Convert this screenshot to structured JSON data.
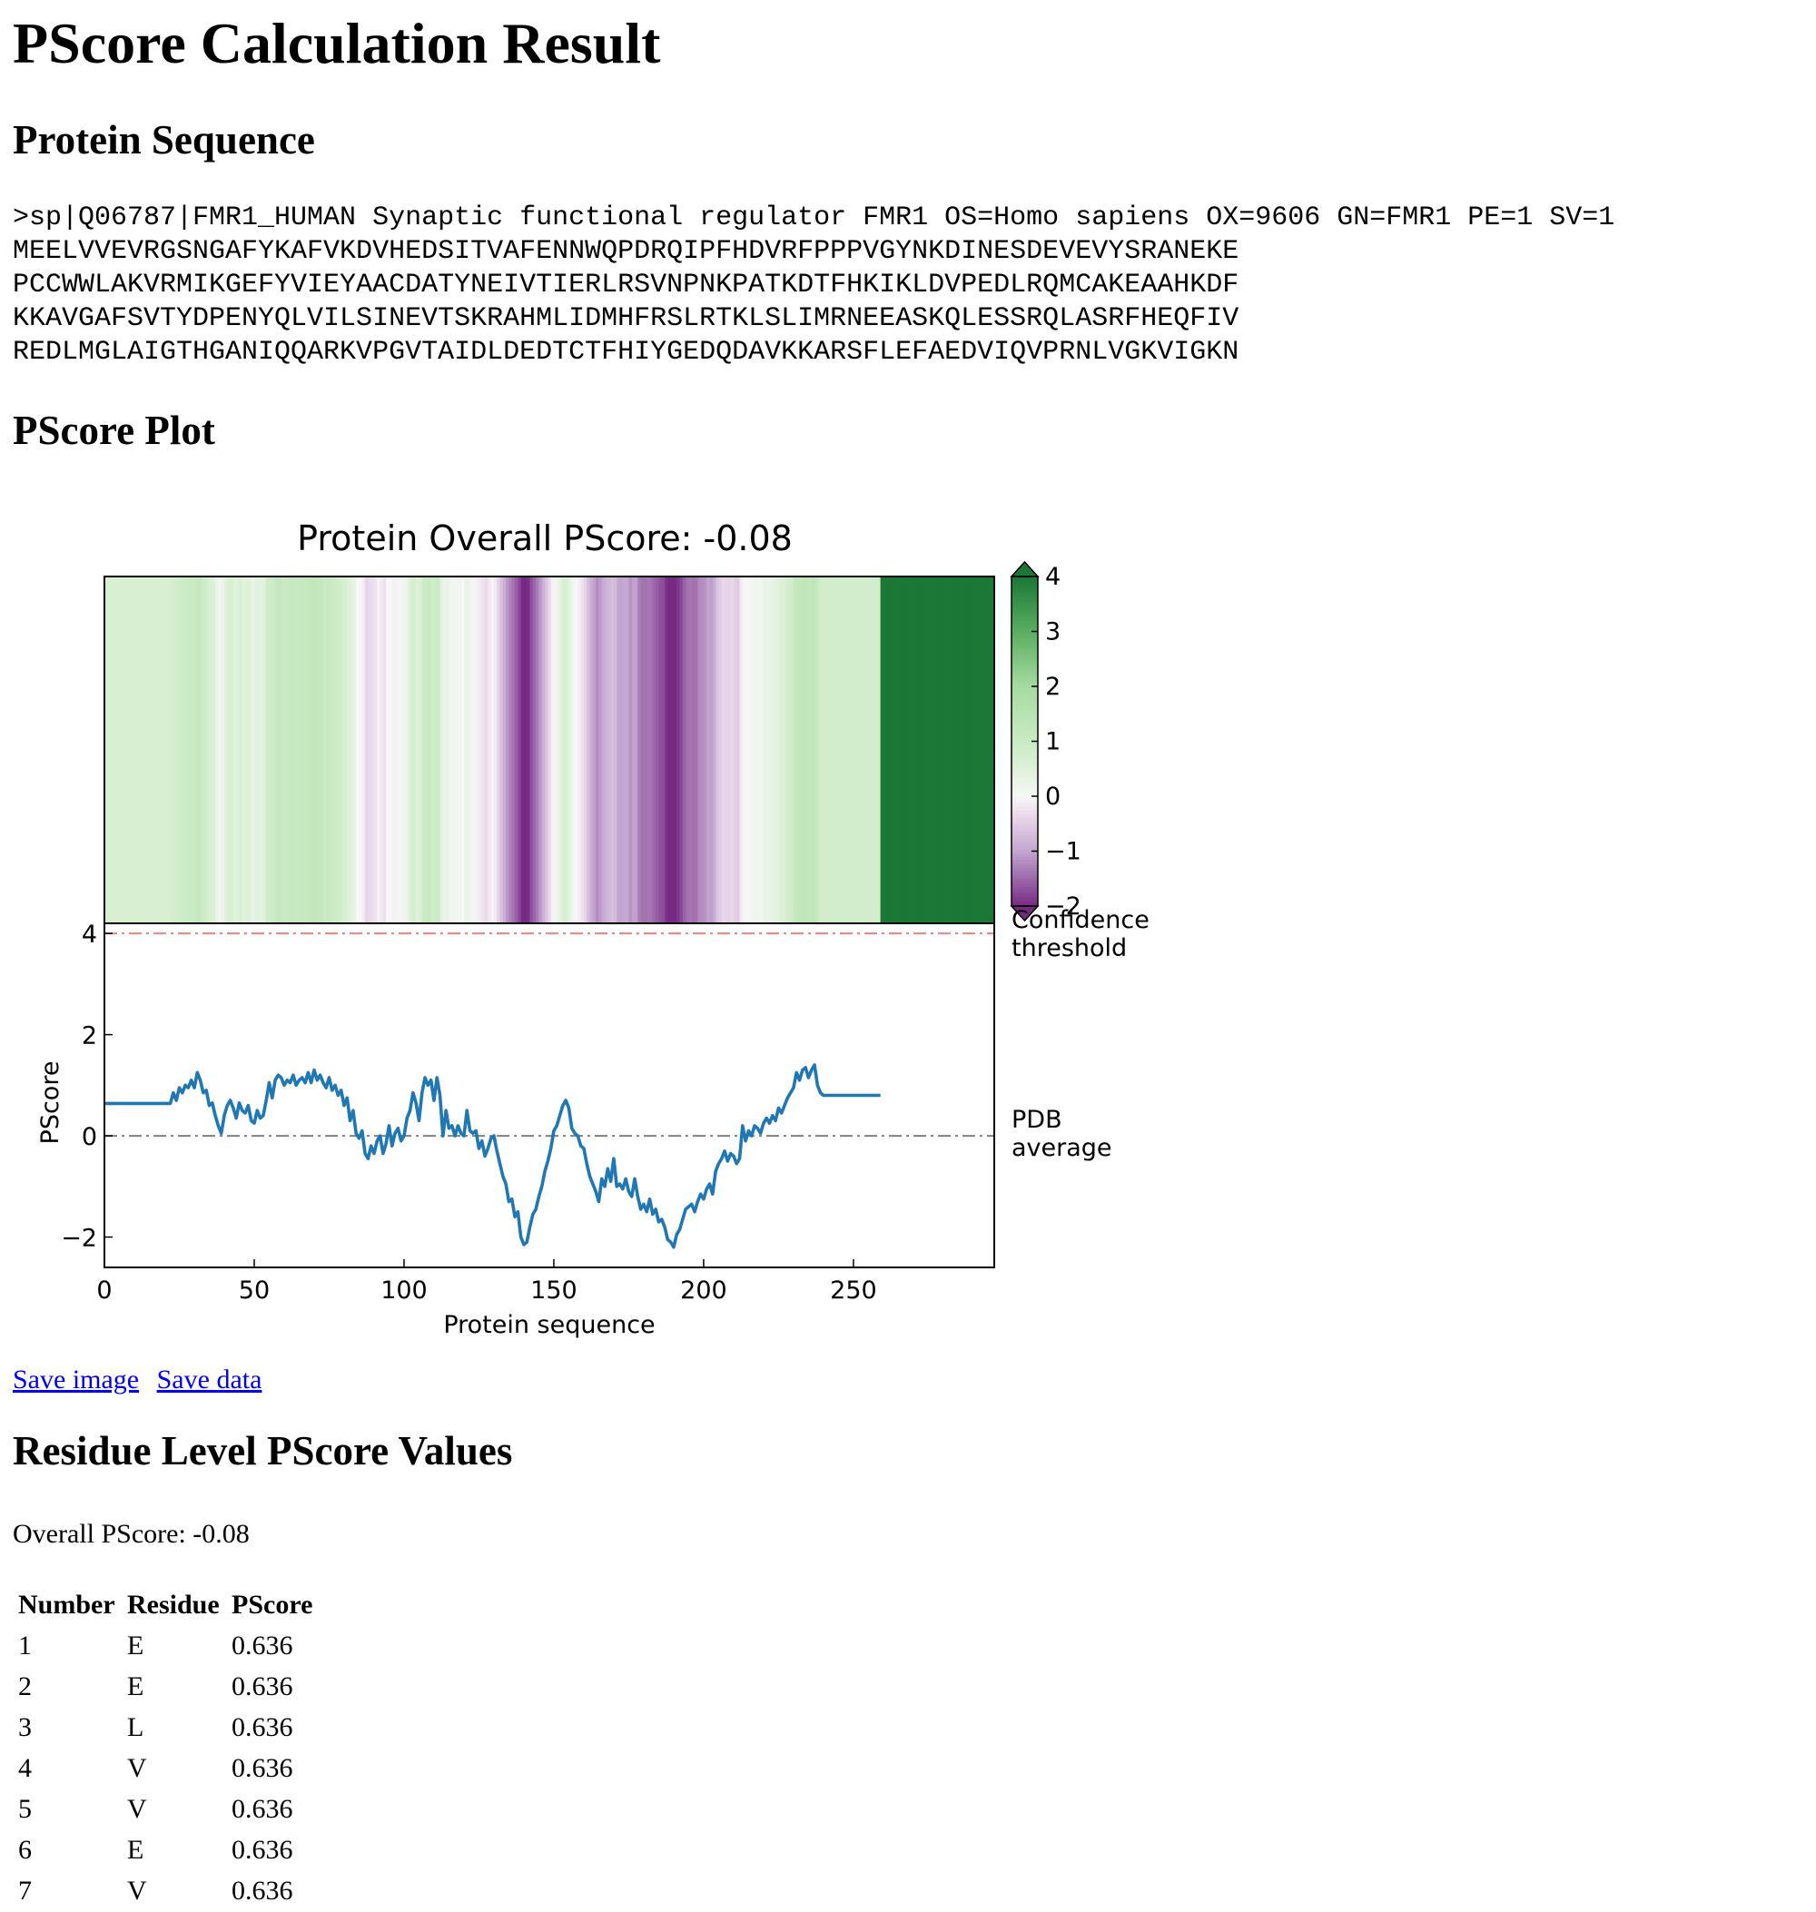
{
  "page_title": "PScore Calculation Result",
  "sections": {
    "sequence_heading": "Protein Sequence",
    "plot_heading": "PScore Plot",
    "residue_heading": "Residue Level PScore Values"
  },
  "sequence": {
    "header": ">sp|Q06787|FMR1_HUMAN Synaptic functional regulator FMR1 OS=Homo sapiens OX=9606 GN=FMR1 PE=1 SV=1",
    "lines": [
      "MEELVVEVRGSNGAFYKAFVKDVHEDSITVAFENNWQPDRQIPFHDVRFPPPVGYNKDINESDEVEVYSRANEKE",
      "PCCWWLAKVRMIKGEFYVIEYAACDATYNEIVTIERLRSVNPNKPATKDTFHKIKLDVPEDLRQMCAKEAAHKDF",
      "KKAVGAFSVTYDPENYQLVILSINEVTSKRAHMLIDMHFRSLRTKLSLIMRNEEASKQLESSRQLASRFHEQFIV",
      "REDLMGLAIGTHGANIQQARKVPGVTAIDLDEDTCTFHIYGEDQDAVKKARSFLEFAEDVIQVPRNLVGKVIGKN"
    ]
  },
  "links": {
    "save_image": "Save image",
    "save_data": "Save data"
  },
  "overall_text": "Overall PScore: -0.08",
  "table": {
    "headers": [
      "Number",
      "Residue",
      "PScore"
    ],
    "rows": [
      [
        "1",
        "E",
        "0.636"
      ],
      [
        "2",
        "E",
        "0.636"
      ],
      [
        "3",
        "L",
        "0.636"
      ],
      [
        "4",
        "V",
        "0.636"
      ],
      [
        "5",
        "V",
        "0.636"
      ],
      [
        "6",
        "E",
        "0.636"
      ],
      [
        "7",
        "V",
        "0.636"
      ]
    ]
  },
  "chart_data": {
    "type": "line",
    "title": "Protein Overall PScore: -0.08",
    "xlabel": "Protein sequence",
    "ylabel": "PScore",
    "xlim": [
      0,
      297
    ],
    "ylim": [
      -2.6,
      4.2
    ],
    "xticks": [
      "0",
      "50",
      "100",
      "150",
      "200",
      "250"
    ],
    "yticks": [
      "4",
      "2",
      "0",
      "−2"
    ],
    "reference_lines": [
      {
        "label": "Confidence threshold",
        "y": 4,
        "color": "#f08080"
      },
      {
        "label": "PDB average",
        "y": 0,
        "color": "#808080"
      }
    ],
    "colorbar": {
      "ticks": [
        "4",
        "3",
        "2",
        "1",
        "0",
        "−1",
        "−2"
      ],
      "range": [
        -2,
        4
      ],
      "colormap": "PRGn",
      "overlapping_label": "Confidence threshold"
    },
    "series_color": "#1f77b4",
    "series": [
      {
        "values_x": [
          0,
          22,
          23,
          24,
          25,
          26,
          27,
          28,
          29,
          30,
          31,
          32,
          33,
          34,
          35,
          36,
          37,
          38,
          39,
          40,
          41,
          42,
          43,
          44,
          45,
          46,
          47,
          48,
          49,
          50,
          51,
          52,
          53,
          54,
          55,
          56,
          57,
          58,
          59,
          60,
          61,
          62,
          63,
          64,
          65,
          66,
          67,
          68,
          69,
          70,
          71,
          72,
          73,
          74,
          75,
          76,
          77,
          78,
          79,
          80,
          81,
          82,
          83,
          84,
          85,
          86,
          87,
          88,
          89,
          90,
          91,
          92,
          93,
          94,
          95,
          96,
          97,
          98,
          99,
          100,
          101,
          102,
          103,
          104,
          105,
          106,
          107,
          108,
          109,
          110,
          111,
          112,
          113,
          114,
          115,
          116,
          117,
          118,
          119,
          120,
          121,
          122,
          123,
          124,
          125,
          126,
          127,
          128,
          129,
          130,
          131,
          132,
          133,
          134,
          135,
          136,
          137,
          138,
          139,
          140,
          141,
          142,
          143,
          144,
          145,
          146,
          147,
          148,
          149,
          150,
          151,
          152,
          153,
          154,
          155,
          156,
          157,
          158,
          159,
          160,
          161,
          162,
          163,
          164,
          165,
          166,
          167,
          168,
          169,
          170,
          171,
          172,
          173,
          174,
          175,
          176,
          177,
          178,
          179,
          180,
          181,
          182,
          183,
          184,
          185,
          186,
          187,
          188,
          189,
          190,
          191,
          192,
          193,
          194,
          195,
          196,
          197,
          198,
          199,
          200,
          201,
          202,
          203,
          204,
          205,
          206,
          207,
          208,
          209,
          210,
          211,
          212,
          213,
          214,
          215,
          216,
          217,
          218,
          219,
          220,
          221,
          222,
          223,
          224,
          225,
          226,
          227,
          228,
          229,
          230,
          231,
          232,
          233,
          234,
          235,
          236,
          237,
          238,
          239,
          240,
          241,
          242,
          243,
          244,
          245,
          246,
          247,
          248,
          249,
          250,
          251,
          252,
          253,
          254,
          255,
          256,
          257,
          258,
          259,
          260,
          261,
          262,
          263,
          264,
          265,
          266,
          267,
          268,
          269,
          270,
          271,
          272,
          273,
          274,
          275,
          276,
          277,
          278,
          279,
          280,
          281,
          282,
          283,
          284,
          285,
          286,
          287,
          288,
          289,
          290,
          291,
          292,
          293,
          294,
          295,
          296,
          297
        ],
        "values_y": [
          0.64,
          0.64,
          0.85,
          0.7,
          0.95,
          0.85,
          1.0,
          0.95,
          1.1,
          0.95,
          1.25,
          1.1,
          0.85,
          0.9,
          0.6,
          0.65,
          0.4,
          0.2,
          0.05,
          0.4,
          0.6,
          0.7,
          0.55,
          0.35,
          0.65,
          0.5,
          0.45,
          0.6,
          0.3,
          0.25,
          0.5,
          0.35,
          0.4,
          0.7,
          1.05,
          0.75,
          1.1,
          1.2,
          1.15,
          1.0,
          1.1,
          1.05,
          1.2,
          1.0,
          1.1,
          1.15,
          1.05,
          1.25,
          1.05,
          1.3,
          1.1,
          1.2,
          1.05,
          0.95,
          1.15,
          0.9,
          1.0,
          0.8,
          0.9,
          0.6,
          0.75,
          0.3,
          0.5,
          0.05,
          -0.05,
          0.1,
          -0.35,
          -0.45,
          -0.2,
          -0.35,
          -0.1,
          0.0,
          -0.35,
          -0.15,
          0.2,
          -0.2,
          0.05,
          0.15,
          -0.1,
          0.0,
          0.35,
          0.5,
          0.85,
          0.65,
          0.3,
          0.85,
          1.15,
          1.0,
          1.1,
          0.7,
          1.15,
          0.8,
          0.0,
          0.5,
          0.15,
          0.2,
          0.0,
          0.2,
          0.05,
          0.0,
          0.5,
          0.1,
          0.05,
          0.1,
          -0.25,
          -0.1,
          -0.4,
          -0.25,
          -0.05,
          0.0,
          -0.3,
          -0.55,
          -0.8,
          -0.95,
          -1.3,
          -1.25,
          -1.6,
          -1.5,
          -2.0,
          -2.15,
          -2.1,
          -1.8,
          -1.55,
          -1.45,
          -1.2,
          -1.0,
          -0.7,
          -0.5,
          -0.25,
          0.1,
          0.2,
          0.4,
          0.6,
          0.7,
          0.55,
          0.15,
          0.05,
          0.0,
          -0.2,
          -0.25,
          -0.55,
          -0.8,
          -0.95,
          -1.1,
          -1.3,
          -0.85,
          -1.0,
          -0.65,
          -0.9,
          -0.45,
          -1.0,
          -0.95,
          -1.05,
          -0.85,
          -1.1,
          -1.2,
          -0.85,
          -1.2,
          -1.45,
          -1.35,
          -1.5,
          -1.25,
          -1.55,
          -1.45,
          -1.7,
          -1.65,
          -1.8,
          -2.05,
          -2.1,
          -2.2,
          -1.95,
          -1.85,
          -1.65,
          -1.45,
          -1.4,
          -1.35,
          -1.5,
          -1.3,
          -1.15,
          -1.25,
          -1.05,
          -0.95,
          -1.15,
          -0.7,
          -0.55,
          -0.45,
          -0.3,
          -0.5,
          -0.35,
          -0.4,
          -0.55,
          -0.45,
          0.2,
          -0.1,
          0.1,
          0.0,
          0.2,
          0.15,
          0.05,
          0.25,
          0.35,
          0.25,
          0.4,
          0.3,
          0.55,
          0.45,
          0.6,
          0.75,
          0.85,
          0.95,
          1.25,
          1.1,
          1.3,
          1.35,
          1.15,
          1.3,
          1.4,
          1.0,
          0.85,
          0.8,
          0.8,
          0.8,
          0.8,
          0.8,
          0.8,
          0.8,
          0.8,
          0.8,
          0.8,
          0.8,
          0.8,
          0.8,
          0.8,
          0.8,
          0.8,
          0.8,
          0.8,
          0.8,
          0.8
        ]
      }
    ]
  }
}
